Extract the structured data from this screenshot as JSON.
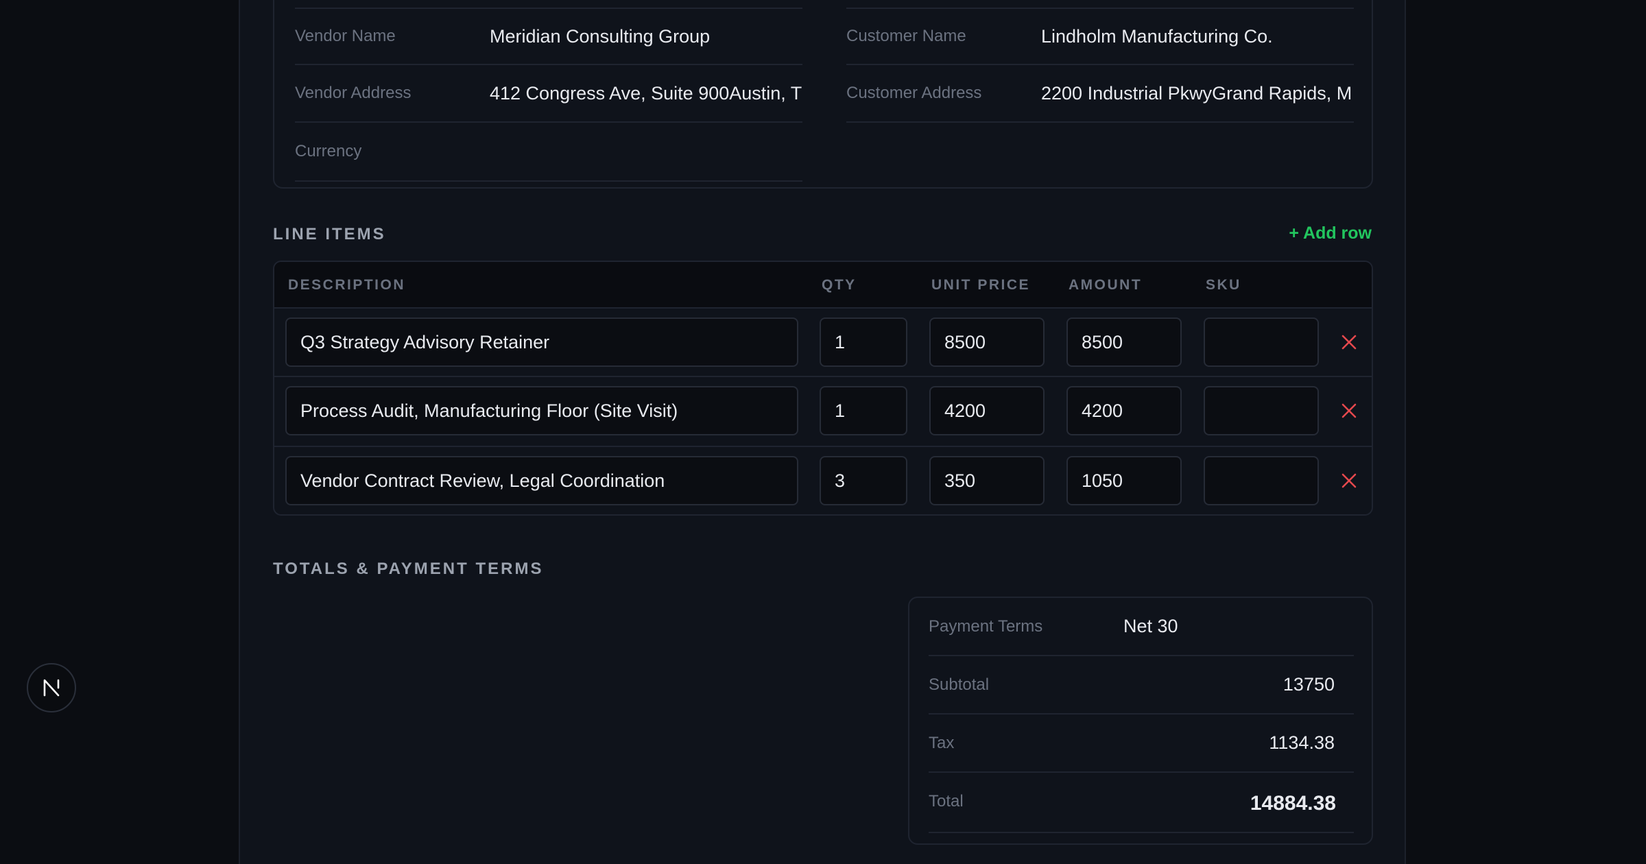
{
  "parties": {
    "vendor": {
      "name_label": "Vendor Name",
      "name_value": "Meridian Consulting Group",
      "address_label": "Vendor Address",
      "address_value": "412 Congress Ave, Suite 900Austin, T",
      "currency_label": "Currency",
      "currency_value": ""
    },
    "customer": {
      "name_label": "Customer Name",
      "name_value": "Lindholm Manufacturing Co.",
      "address_label": "Customer Address",
      "address_value": "2200 Industrial PkwyGrand Rapids, M"
    }
  },
  "line_items": {
    "section_title": "LINE ITEMS",
    "add_row_label": "+ Add row",
    "columns": {
      "description": "DESCRIPTION",
      "qty": "QTY",
      "unit_price": "UNIT PRICE",
      "amount": "AMOUNT",
      "sku": "SKU"
    },
    "rows": [
      {
        "description": "Q3 Strategy Advisory Retainer",
        "qty": "1",
        "unit_price": "8500",
        "amount": "8500",
        "sku": ""
      },
      {
        "description": "Process Audit, Manufacturing Floor (Site Visit)",
        "qty": "1",
        "unit_price": "4200",
        "amount": "4200",
        "sku": ""
      },
      {
        "description": "Vendor Contract Review, Legal Coordination",
        "qty": "3",
        "unit_price": "350",
        "amount": "1050",
        "sku": ""
      }
    ]
  },
  "totals": {
    "section_title": "TOTALS & PAYMENT TERMS",
    "payment_terms_label": "Payment Terms",
    "payment_terms_value": "Net 30",
    "subtotal_label": "Subtotal",
    "subtotal_value": "13750",
    "tax_label": "Tax",
    "tax_value": "1134.38",
    "total_label": "Total",
    "total_value": "14884.38"
  },
  "badge": {
    "letter": "N"
  },
  "colors": {
    "accent_green": "#22c55e",
    "delete_red": "#e5484d",
    "background": "#0b0d12",
    "panel": "#0f131b"
  }
}
